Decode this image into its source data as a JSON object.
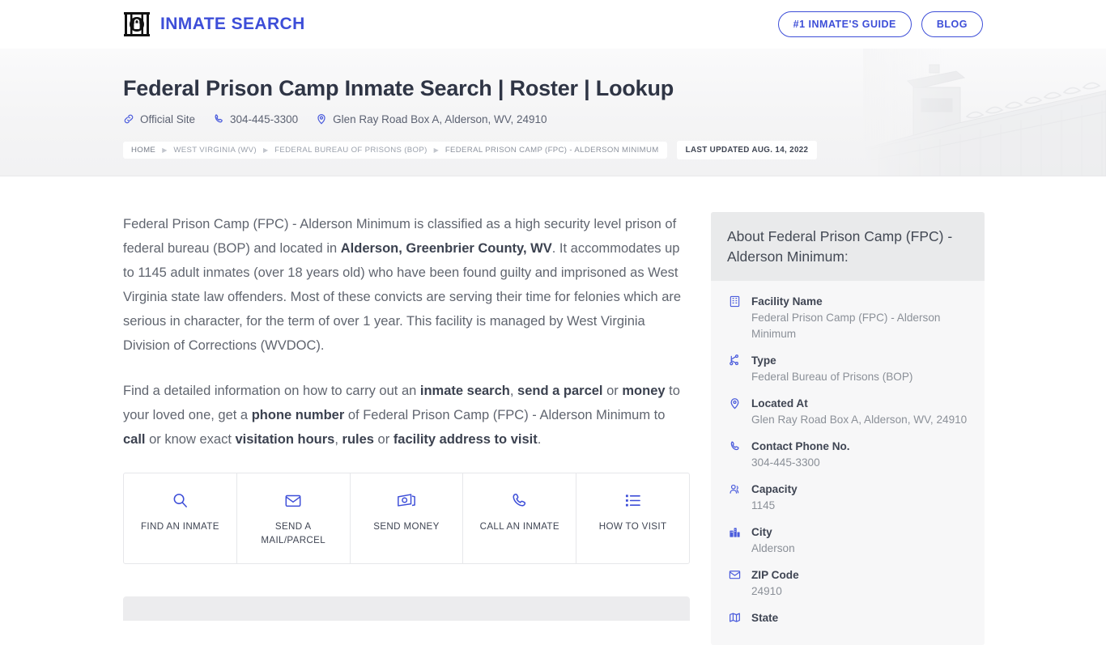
{
  "brand": {
    "name": "INMATE SEARCH",
    "logo_icon": "jail-window-lock-icon",
    "accent_color": "#3d4ed8"
  },
  "nav": {
    "guide_label": "#1 INMATE'S GUIDE",
    "blog_label": "BLOG"
  },
  "hero": {
    "title": "Federal Prison Camp Inmate Search | Roster | Lookup",
    "meta": [
      {
        "icon": "link-icon",
        "text": "Official Site"
      },
      {
        "icon": "phone-icon",
        "text": "304-445-3300"
      },
      {
        "icon": "map-pin-icon",
        "text": "Glen Ray Road Box A, Alderson, WV, 24910"
      }
    ],
    "breadcrumbs": [
      "HOME",
      "WEST VIRGINIA (WV)",
      "FEDERAL BUREAU OF PRISONS (BOP)",
      "FEDERAL PRISON CAMP (FPC) - ALDERSON MINIMUM"
    ],
    "last_updated": "LAST UPDATED AUG. 14, 2022",
    "background_art": "prison-watchtower-fence-illustration"
  },
  "main": {
    "paragraph1": {
      "t1": "Federal Prison Camp (FPC) - Alderson Minimum is classified as a high security level prison of federal bureau (BOP) and located in ",
      "b1": "Alderson, Greenbrier County, WV",
      "t2": ". It accommodates up to 1145 adult inmates (over 18 years old) who have been found guilty and imprisoned as West Virginia state law offenders. Most of these convicts are serving their time for felonies which are serious in character, for the term of over 1 year. This facility is managed by West Virginia Division of Corrections (WVDOC)."
    },
    "paragraph2": {
      "t1": "Find a detailed information on how to carry out an ",
      "b1": "inmate search",
      "t2": ", ",
      "b2": "send a parcel",
      "t3": " or ",
      "b3": "money",
      "t4": " to your loved one, get a ",
      "b4": "phone number",
      "t5": " of Federal Prison Camp (FPC) - Alderson Minimum to ",
      "b5": "call",
      "t6": " or know exact ",
      "b6": "visitation hours",
      "t7": ", ",
      "b7": "rules",
      "t8": " or ",
      "b8": "facility address to visit",
      "t9": "."
    },
    "tiles": [
      {
        "icon": "search-icon",
        "label": "FIND AN INMATE"
      },
      {
        "icon": "envelope-icon",
        "label": "SEND A MAIL/PARCEL"
      },
      {
        "icon": "money-bill-icon",
        "label": "SEND MONEY"
      },
      {
        "icon": "phone-icon",
        "label": "CALL AN INMATE"
      },
      {
        "icon": "list-check-icon",
        "label": "HOW TO VISIT"
      }
    ]
  },
  "sidebar": {
    "card_title": "About Federal Prison Camp (FPC) - Alderson Minimum:",
    "facts": [
      {
        "icon": "building-grid-icon",
        "label": "Facility Name",
        "value": "Federal Prison Camp (FPC) - Alderson Minimum"
      },
      {
        "icon": "sitemap-icon",
        "label": "Type",
        "value": "Federal Bureau of Prisons (BOP)"
      },
      {
        "icon": "map-pin-icon",
        "label": "Located At",
        "value": "Glen Ray Road Box A, Alderson, WV, 24910"
      },
      {
        "icon": "phone-icon",
        "label": "Contact Phone No.",
        "value": "304-445-3300"
      },
      {
        "icon": "users-icon",
        "label": "Capacity",
        "value": "1145"
      },
      {
        "icon": "city-icon",
        "label": "City",
        "value": "Alderson"
      },
      {
        "icon": "envelope-icon",
        "label": "ZIP Code",
        "value": "24910"
      },
      {
        "icon": "map-icon",
        "label": "State",
        "value": ""
      }
    ]
  }
}
